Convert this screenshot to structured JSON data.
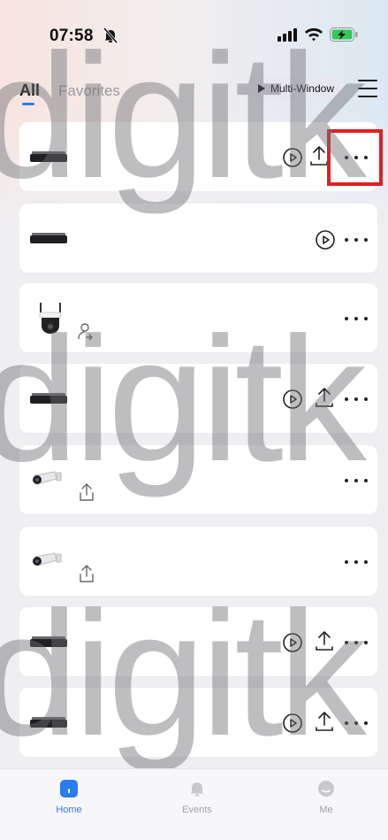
{
  "status_bar": {
    "time": "07:58",
    "bell_icon": "bell-muted-icon",
    "signal_icon": "cellular-signal-icon",
    "wifi_icon": "wifi-icon",
    "battery_icon": "battery-charging-icon",
    "battery_color": "#34c759"
  },
  "header": {
    "tabs": [
      {
        "label": "All",
        "active": true
      },
      {
        "label": "Favorites",
        "active": false
      }
    ],
    "multi_window_label": "Multi-Window",
    "menu_icon": "hamburger-menu-icon",
    "accent_color": "#2a7cf0"
  },
  "devices": [
    {
      "type": "nvr",
      "actions": [
        "play",
        "share",
        "more"
      ],
      "highlighted": true
    },
    {
      "type": "nvr",
      "actions": [
        "play",
        "more"
      ]
    },
    {
      "type": "ptz-camera",
      "actions": [
        "more"
      ],
      "shared_user_badge": true
    },
    {
      "type": "nvr",
      "actions": [
        "play",
        "share",
        "more"
      ]
    },
    {
      "type": "bullet-camera",
      "actions": [
        "more"
      ],
      "share_badge": true
    },
    {
      "type": "bullet-camera",
      "actions": [
        "more"
      ],
      "share_badge": true
    },
    {
      "type": "nvr",
      "actions": [
        "play",
        "share",
        "more"
      ]
    },
    {
      "type": "nvr",
      "actions": [
        "play",
        "share",
        "more"
      ]
    }
  ],
  "highlight_color": "#e02020",
  "watermark_text": "digitk",
  "bottom_nav": [
    {
      "label": "Home",
      "icon": "home-icon",
      "active": true
    },
    {
      "label": "Events",
      "icon": "bell-icon",
      "active": false
    },
    {
      "label": "Me",
      "icon": "profile-icon",
      "active": false
    }
  ]
}
